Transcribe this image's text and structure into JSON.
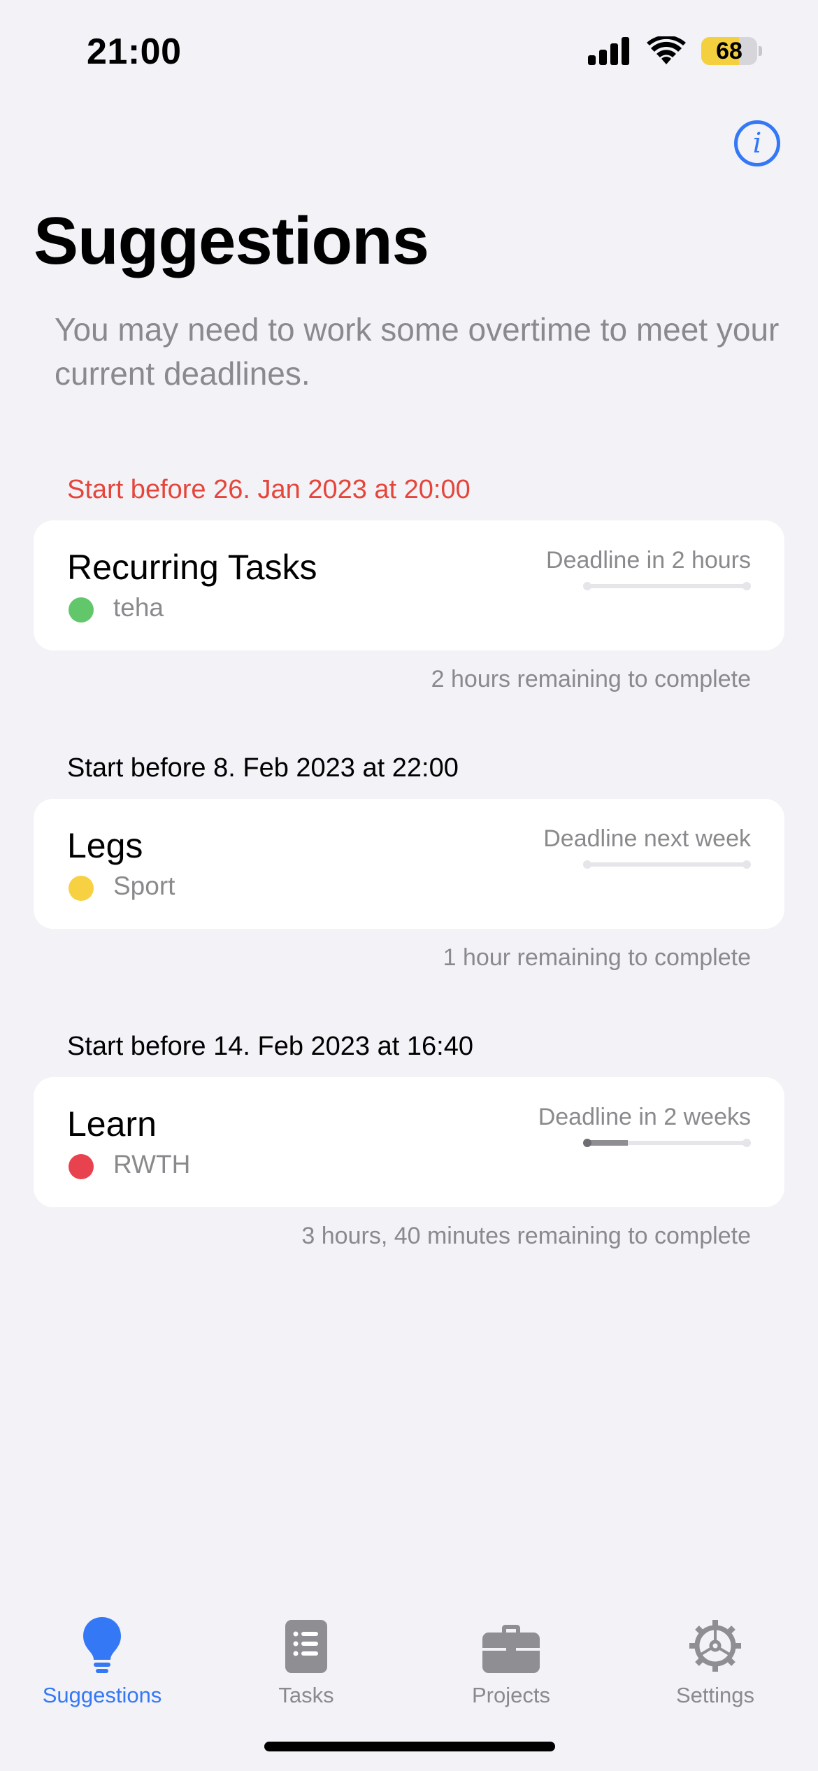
{
  "status_bar": {
    "time": "21:00",
    "battery": "68"
  },
  "header": {
    "title": "Suggestions",
    "subtitle": "You may need to work some overtime to meet your current deadlines."
  },
  "sections": [
    {
      "header": "Start before 26. Jan 2023 at 20:00",
      "task": "Recurring Tasks",
      "project": "teha",
      "project_color": "#62c66a",
      "deadline": "Deadline in 2 hours",
      "progress": 0,
      "remaining": "2 hours remaining to complete"
    },
    {
      "header": "Start before 8. Feb 2023 at 22:00",
      "task": "Legs",
      "project": "Sport",
      "project_color": "#f7d142",
      "deadline": "Deadline next week",
      "progress": 0,
      "remaining": "1 hour remaining to complete"
    },
    {
      "header": "Start before 14. Feb 2023 at 16:40",
      "task": "Learn",
      "project": "RWTH",
      "project_color": "#e8424f",
      "deadline": "Deadline in 2 weeks",
      "progress": 0.25,
      "remaining": "3 hours, 40 minutes remaining to complete"
    }
  ],
  "colors": {
    "accent": "#3478f6",
    "overdue": "#e5453a",
    "inactive": "#8a8a8e"
  },
  "tabbar": {
    "tabs": [
      {
        "label": "Suggestions",
        "icon": "lightbulb-icon",
        "active": true
      },
      {
        "label": "Tasks",
        "icon": "list-icon",
        "active": false
      },
      {
        "label": "Projects",
        "icon": "briefcase-icon",
        "active": false
      },
      {
        "label": "Settings",
        "icon": "gear-icon",
        "active": false
      }
    ]
  }
}
